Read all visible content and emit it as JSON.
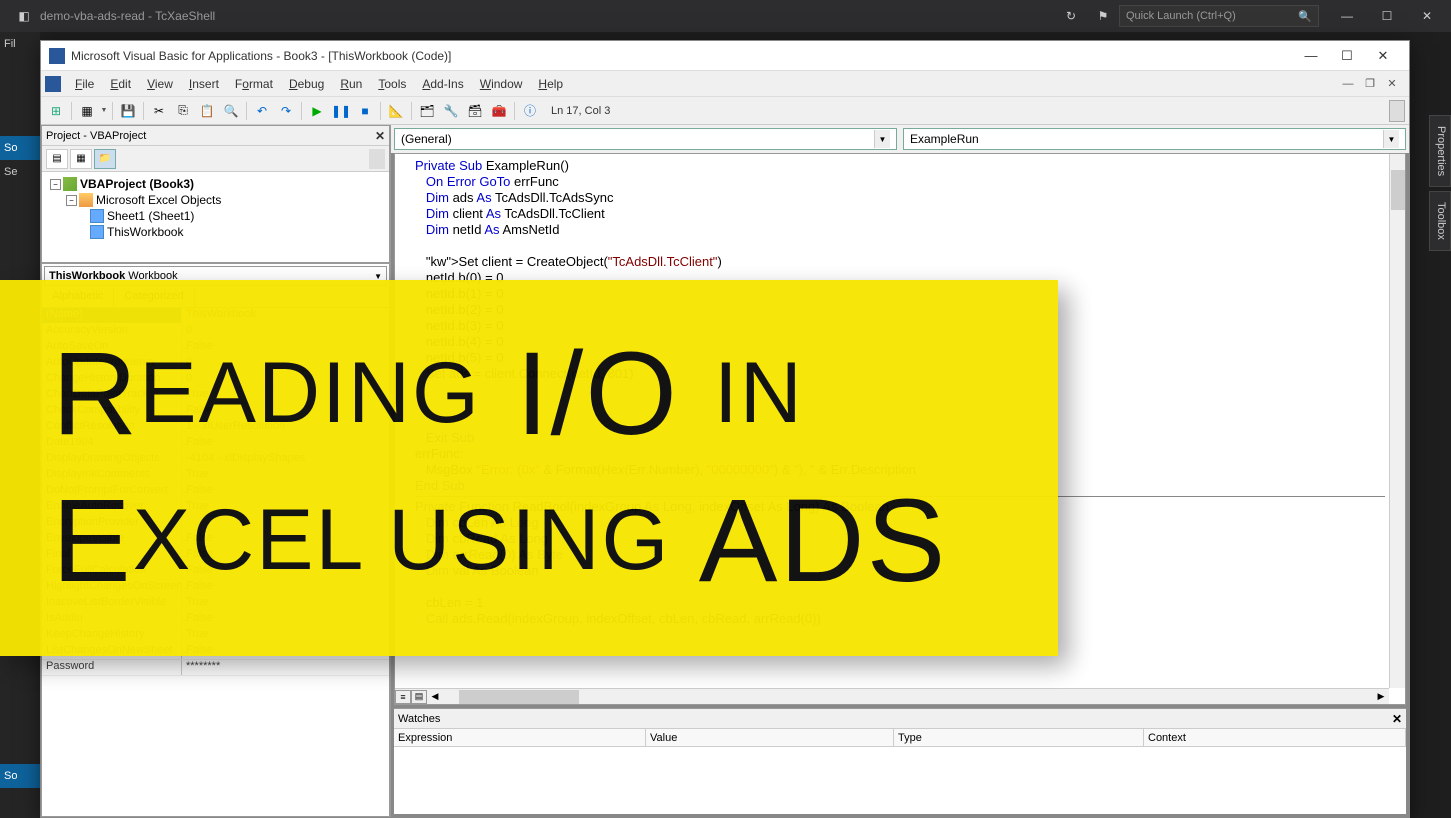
{
  "outer": {
    "title": "demo-vba-ads-read - TcXaeShell",
    "quick_launch_placeholder": "Quick Launch (Ctrl+Q)"
  },
  "left_edge": {
    "file": "Fil",
    "so1": "So",
    "se": "Se",
    "so2": "So"
  },
  "vba": {
    "title": "Microsoft Visual Basic for Applications - Book3 - [ThisWorkbook (Code)]",
    "menus": {
      "file": "File",
      "edit": "Edit",
      "view": "View",
      "insert": "Insert",
      "format": "Format",
      "debug": "Debug",
      "run": "Run",
      "tools": "Tools",
      "addins": "Add-Ins",
      "window": "Window",
      "help": "Help"
    },
    "ln_col": "Ln 17, Col 3",
    "project_title": "Project - VBAProject",
    "tree": {
      "root": "VBAProject (Book3)",
      "folder": "Microsoft Excel Objects",
      "sheet": "Sheet1 (Sheet1)",
      "workbook": "ThisWorkbook"
    },
    "props": {
      "dropdown_name": "ThisWorkbook",
      "dropdown_type": "Workbook",
      "tab_alpha": "Alphabetic",
      "tab_cat": "Categorized",
      "rows": [
        {
          "name": "(Name)",
          "val": "ThisWorkbook"
        },
        {
          "name": "AccuracyVersion",
          "val": "0"
        },
        {
          "name": "AutoSaveOn",
          "val": "False"
        },
        {
          "name": "AutoUpdateFrequency",
          "val": "0"
        },
        {
          "name": "ChangeHistoryDuration",
          "val": "0"
        },
        {
          "name": "ChartDataPointTrack",
          "val": "True"
        },
        {
          "name": "CheckCompatibility",
          "val": "False"
        },
        {
          "name": "ConflictResolution",
          "val": "1 - xlUserResolution"
        },
        {
          "name": "Date1904",
          "val": "False"
        },
        {
          "name": "DisplayDrawingObjects",
          "val": "-4104 - xlDisplayShapes"
        },
        {
          "name": "DisplayInkComments",
          "val": "True"
        },
        {
          "name": "DoNotPromptForConvert",
          "val": "False"
        },
        {
          "name": "EnableAutoRecover",
          "val": "True"
        },
        {
          "name": "EncryptionProvider",
          "val": ""
        },
        {
          "name": "EnvelopeVisible",
          "val": "False"
        },
        {
          "name": "Final",
          "val": "False"
        },
        {
          "name": "ForceFullCalculation",
          "val": "False"
        },
        {
          "name": "HighlightChangesOnScreen",
          "val": "False"
        },
        {
          "name": "InactiveListBorderVisible",
          "val": "True"
        },
        {
          "name": "IsAddin",
          "val": "False"
        },
        {
          "name": "KeepChangeHistory",
          "val": "True"
        },
        {
          "name": "ListChangesOnNewSheet",
          "val": "False"
        },
        {
          "name": "Password",
          "val": "********"
        }
      ]
    },
    "code": {
      "dd_left": "(General)",
      "dd_right": "ExampleRun",
      "lines": [
        {
          "t": "Private Sub ExampleRun()",
          "kw": [
            "Private",
            "Sub"
          ]
        },
        {
          "t": "   On Error GoTo errFunc",
          "kw": [
            "On",
            "Error",
            "GoTo"
          ]
        },
        {
          "t": "   Dim ads As TcAdsDll.TcAdsSync",
          "kw": [
            "Dim",
            "As"
          ]
        },
        {
          "t": "   Dim client As TcAdsDll.TcClient",
          "kw": [
            "Dim",
            "As"
          ]
        },
        {
          "t": "   Dim netId As AmsNetId",
          "kw": [
            "Dim",
            "As"
          ]
        },
        {
          "t": "",
          "kw": []
        },
        {
          "t": "   Set client = CreateObject(\"TcAdsDll.TcClient\")",
          "kw": [
            "Set"
          ],
          "str": "\"TcAdsDll.TcClient\""
        },
        {
          "t": "   netId.b(0) = 0",
          "kw": []
        },
        {
          "t": "   netId.b(1) = 0",
          "kw": []
        },
        {
          "t": "   netId.b(2) = 0",
          "kw": []
        },
        {
          "t": "   netId.b(3) = 0",
          "kw": []
        },
        {
          "t": "   netId.b(4) = 0",
          "kw": []
        },
        {
          "t": "   netId.b(5) = 0",
          "kw": []
        },
        {
          "t": "   Set ads = client.Connect(netId, 801)",
          "kw": [
            "Set"
          ]
        },
        {
          "t": "",
          "kw": []
        },
        {
          "t": "",
          "kw": []
        },
        {
          "t": "",
          "kw": []
        },
        {
          "t": "   Exit Sub",
          "kw": [
            "Exit",
            "Sub"
          ]
        },
        {
          "t": "errFunc:",
          "kw": []
        },
        {
          "t": "   MsgBox \"Error: (0x\" & Format(Hex(Err.Number), \"00000000\") & \"), \" & Err.Description",
          "kw": [],
          "str": "\"Error: (0x\""
        },
        {
          "t": "End Sub",
          "kw": [
            "End",
            "Sub"
          ]
        }
      ],
      "func2": [
        {
          "t": "Private Function ReadBool(indexGroup As Long, indexOffset As Long) As Boolean",
          "kw": [
            "Private",
            "Function",
            "As",
            "Long",
            "As",
            "Long",
            "As",
            "Boolean"
          ]
        },
        {
          "t": "   Dim cbLen As Long",
          "kw": [
            "Dim",
            "As",
            "Long"
          ]
        },
        {
          "t": "   Dim cbRead As Long",
          "kw": [
            "Dim",
            "As",
            "Long"
          ]
        },
        {
          "t": "   Dim arrRead(0) As Byte",
          "kw": [
            "Dim",
            "As",
            "Byte"
          ]
        },
        {
          "t": "   Dim val As Boolean",
          "kw": [
            "Dim",
            "As",
            "Boolean"
          ]
        },
        {
          "t": "",
          "kw": []
        },
        {
          "t": "   cbLen = 1",
          "kw": []
        },
        {
          "t": "   Call ads.Read(indexGroup, indexOffset, cbLen, cbRead, arrRead(0))",
          "kw": [
            "Call"
          ]
        }
      ]
    },
    "watches": {
      "title": "Watches",
      "cols": {
        "exp": "Expression",
        "val": "Value",
        "type": "Type",
        "ctx": "Context"
      }
    }
  },
  "side_tabs": {
    "properties": "Properties",
    "toolbox": "Toolbox"
  },
  "banner": {
    "line1_a": "R",
    "line1_b": "eading",
    "line1_c": " I/O ",
    "line1_d": "in",
    "line2_a": "E",
    "line2_b": "xcel using",
    "line2_c": " ADS"
  }
}
